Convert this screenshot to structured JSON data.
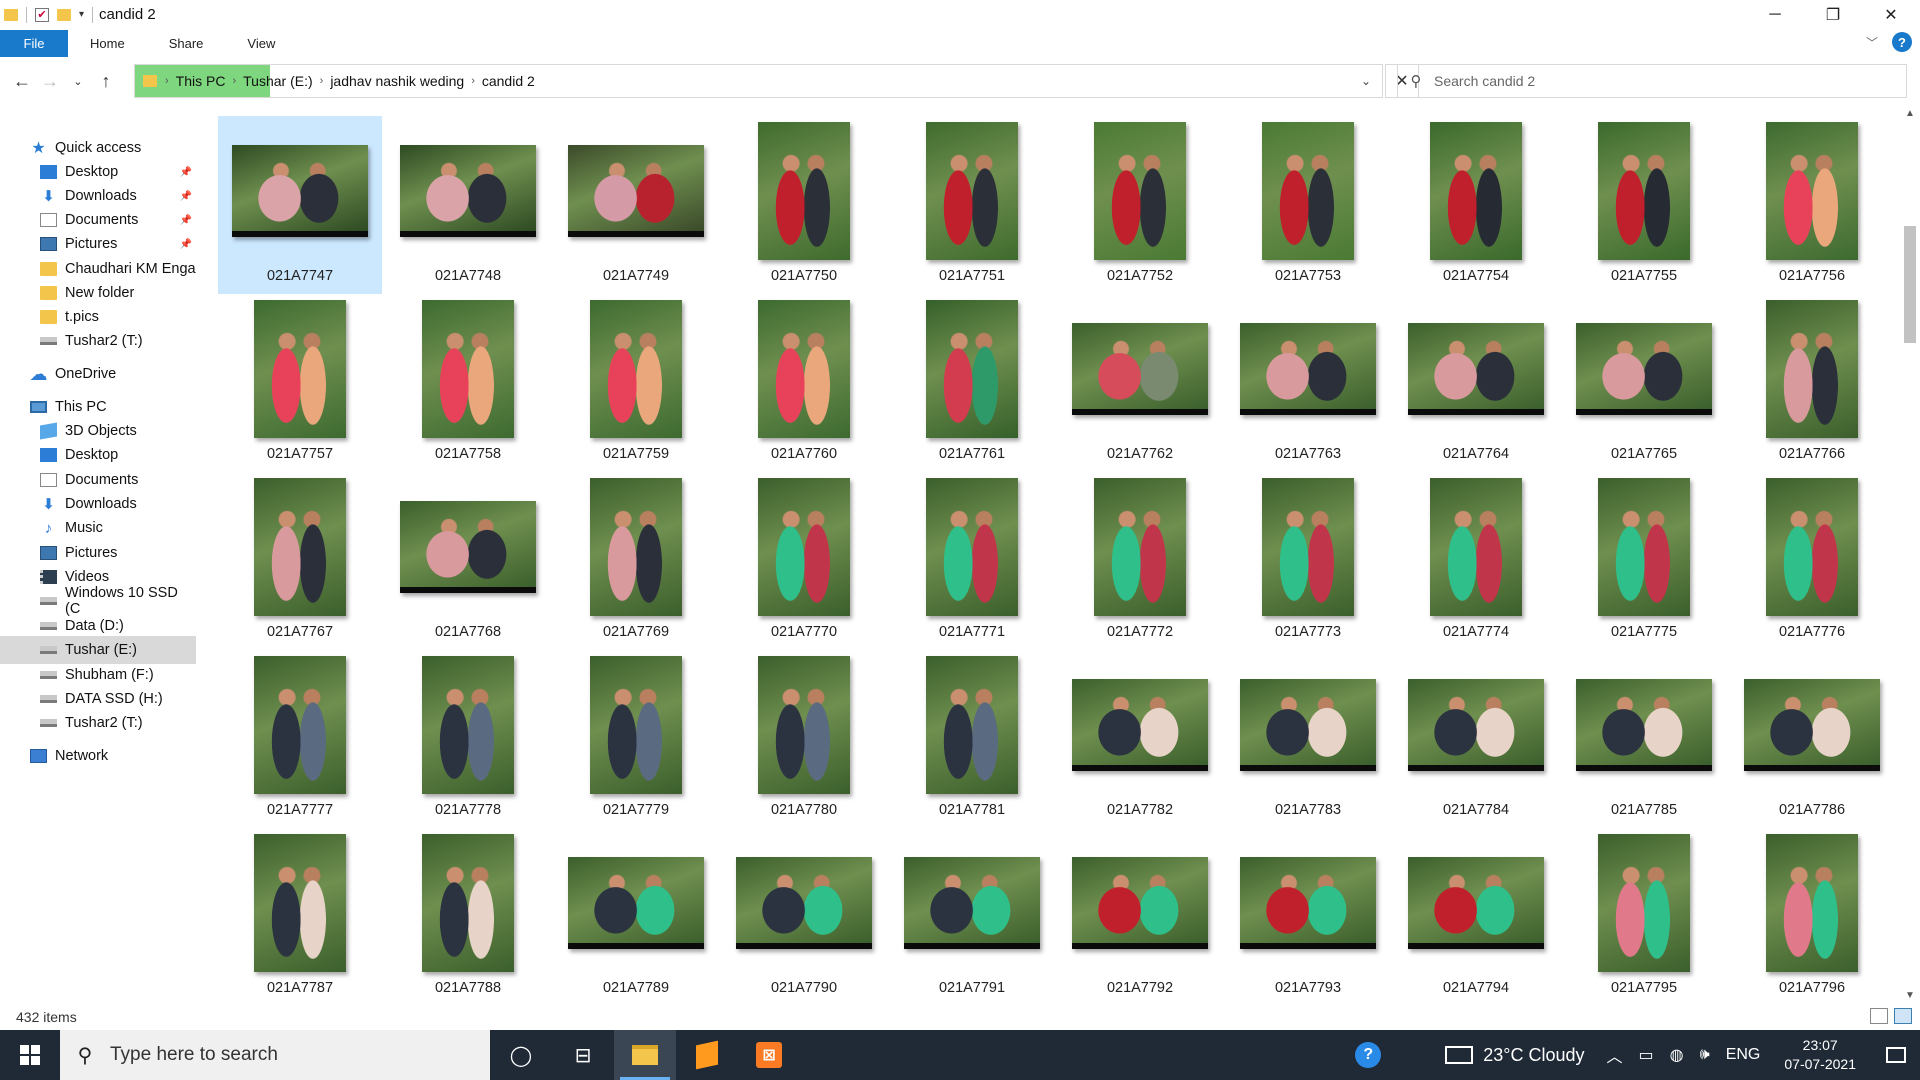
{
  "window": {
    "title": "candid 2",
    "controls": [
      "─",
      "❐",
      "✕"
    ]
  },
  "ribbon": {
    "tabs": [
      "File",
      "Home",
      "Share",
      "View"
    ]
  },
  "address": {
    "crumbs": [
      "This PC",
      "Tushar (E:)",
      "jadhav nashik weding",
      "candid 2"
    ]
  },
  "search": {
    "placeholder": "Search candid 2"
  },
  "sidebar": {
    "items": [
      {
        "label": "Quick access",
        "icon": "star-icon",
        "indent": 0,
        "pinned": false
      },
      {
        "label": "Desktop",
        "icon": "desktop-icon",
        "indent": 1,
        "pinned": true
      },
      {
        "label": "Downloads",
        "icon": "downloads-icon",
        "indent": 1,
        "pinned": true
      },
      {
        "label": "Documents",
        "icon": "documents-icon",
        "indent": 1,
        "pinned": true
      },
      {
        "label": "Pictures",
        "icon": "pictures-icon",
        "indent": 1,
        "pinned": true
      },
      {
        "label": "Chaudhari KM Enga",
        "icon": "folder-icon",
        "indent": 1,
        "pinned": false
      },
      {
        "label": "New folder",
        "icon": "folder-icon",
        "indent": 1,
        "pinned": false
      },
      {
        "label": "t.pics",
        "icon": "folder-icon",
        "indent": 1,
        "pinned": false
      },
      {
        "label": "Tushar2 (T:)",
        "icon": "drive-icon",
        "indent": 1,
        "pinned": false
      },
      {
        "label": "OneDrive",
        "icon": "cloud-icon",
        "indent": 0,
        "pinned": false
      },
      {
        "label": "This PC",
        "icon": "pc-icon",
        "indent": 0,
        "pinned": false
      },
      {
        "label": "3D Objects",
        "icon": "3d-objects-icon",
        "indent": 1,
        "pinned": false
      },
      {
        "label": "Desktop",
        "icon": "desktop-icon",
        "indent": 1,
        "pinned": false
      },
      {
        "label": "Documents",
        "icon": "documents-icon",
        "indent": 1,
        "pinned": false
      },
      {
        "label": "Downloads",
        "icon": "downloads-icon",
        "indent": 1,
        "pinned": false
      },
      {
        "label": "Music",
        "icon": "music-icon",
        "indent": 1,
        "pinned": false
      },
      {
        "label": "Pictures",
        "icon": "pictures-icon",
        "indent": 1,
        "pinned": false
      },
      {
        "label": "Videos",
        "icon": "videos-icon",
        "indent": 1,
        "pinned": false
      },
      {
        "label": "Windows 10 SSD (C",
        "icon": "drive-icon",
        "indent": 1,
        "pinned": false
      },
      {
        "label": "Data (D:)",
        "icon": "drive-icon",
        "indent": 1,
        "pinned": false
      },
      {
        "label": "Tushar (E:)",
        "icon": "drive-icon",
        "indent": 1,
        "pinned": false,
        "selected": true
      },
      {
        "label": "Shubham (F:)",
        "icon": "drive-icon",
        "indent": 1,
        "pinned": false
      },
      {
        "label": "DATA SSD (H:)",
        "icon": "drive-icon",
        "indent": 1,
        "pinned": false
      },
      {
        "label": "Tushar2 (T:)",
        "icon": "drive-icon",
        "indent": 1,
        "pinned": false
      },
      {
        "label": "Network",
        "icon": "network-icon",
        "indent": 0,
        "pinned": false
      }
    ]
  },
  "files": [
    {
      "name": "021A7747",
      "orientation": "landscape",
      "palette": [
        "#2d4a22",
        "#d9a3a8",
        "#2a2f3a"
      ]
    },
    {
      "name": "021A7748",
      "orientation": "landscape",
      "palette": [
        "#2d4a22",
        "#d9a3a8",
        "#2a2f3a"
      ]
    },
    {
      "name": "021A7749",
      "orientation": "landscape",
      "palette": [
        "#3b4a2a",
        "#d49aa6",
        "#b8222e"
      ]
    },
    {
      "name": "021A7750",
      "orientation": "portrait",
      "palette": [
        "#3f6b2e",
        "#c0202b",
        "#2b2f38"
      ]
    },
    {
      "name": "021A7751",
      "orientation": "portrait",
      "palette": [
        "#3f6b2e",
        "#c0202b",
        "#2b2f38"
      ]
    },
    {
      "name": "021A7752",
      "orientation": "portrait",
      "palette": [
        "#4a7a34",
        "#c0202b",
        "#2b2f38"
      ]
    },
    {
      "name": "021A7753",
      "orientation": "portrait",
      "palette": [
        "#4a7a34",
        "#c0202b",
        "#2b2f38"
      ]
    },
    {
      "name": "021A7754",
      "orientation": "portrait",
      "palette": [
        "#3a6a2c",
        "#c0202b",
        "#262a33"
      ]
    },
    {
      "name": "021A7755",
      "orientation": "portrait",
      "palette": [
        "#3a6a2c",
        "#c0202b",
        "#262a33"
      ]
    },
    {
      "name": "021A7756",
      "orientation": "portrait",
      "palette": [
        "#3d6a30",
        "#e8425a",
        "#e9a77b"
      ]
    },
    {
      "name": "021A7757",
      "orientation": "portrait",
      "palette": [
        "#3d6a30",
        "#e8425a",
        "#e9a77b"
      ]
    },
    {
      "name": "021A7758",
      "orientation": "portrait",
      "palette": [
        "#3d6a30",
        "#e8425a",
        "#e9a77b"
      ]
    },
    {
      "name": "021A7759",
      "orientation": "portrait",
      "palette": [
        "#3d6a30",
        "#e8425a",
        "#e9a77b"
      ]
    },
    {
      "name": "021A7760",
      "orientation": "portrait",
      "palette": [
        "#3d6a30",
        "#e8425a",
        "#e9a77b"
      ]
    },
    {
      "name": "021A7761",
      "orientation": "portrait",
      "palette": [
        "#35602a",
        "#d23c4e",
        "#2e9a6a"
      ]
    },
    {
      "name": "021A7762",
      "orientation": "landscape",
      "palette": [
        "#3b5f2c",
        "#d64c5a",
        "#7a8a70"
      ]
    },
    {
      "name": "021A7763",
      "orientation": "landscape",
      "palette": [
        "#3b5f2c",
        "#d99a9e",
        "#2a2f3a"
      ]
    },
    {
      "name": "021A7764",
      "orientation": "landscape",
      "palette": [
        "#3b5f2c",
        "#d99a9e",
        "#2a2f3a"
      ]
    },
    {
      "name": "021A7765",
      "orientation": "landscape",
      "palette": [
        "#3b5f2c",
        "#d99a9e",
        "#2a2f3a"
      ]
    },
    {
      "name": "021A7766",
      "orientation": "portrait",
      "palette": [
        "#3b5f2c",
        "#d99a9e",
        "#2a2f3a"
      ]
    },
    {
      "name": "021A7767",
      "orientation": "portrait",
      "palette": [
        "#3b5f2c",
        "#d99a9e",
        "#2a2f3a"
      ]
    },
    {
      "name": "021A7768",
      "orientation": "landscape",
      "palette": [
        "#3b5f2c",
        "#d99a9e",
        "#2a2f3a"
      ]
    },
    {
      "name": "021A7769",
      "orientation": "portrait",
      "palette": [
        "#3b5f2c",
        "#d99a9e",
        "#2a2f3a"
      ]
    },
    {
      "name": "021A7770",
      "orientation": "portrait",
      "palette": [
        "#3b5f2c",
        "#2fbf8a",
        "#c0354a"
      ]
    },
    {
      "name": "021A7771",
      "orientation": "portrait",
      "palette": [
        "#3b5f2c",
        "#2fbf8a",
        "#c0354a"
      ]
    },
    {
      "name": "021A7772",
      "orientation": "portrait",
      "palette": [
        "#3b5f2c",
        "#2fbf8a",
        "#c0354a"
      ]
    },
    {
      "name": "021A7773",
      "orientation": "portrait",
      "palette": [
        "#3b5f2c",
        "#2fbf8a",
        "#c0354a"
      ]
    },
    {
      "name": "021A7774",
      "orientation": "portrait",
      "palette": [
        "#3b5f2c",
        "#2fbf8a",
        "#c0354a"
      ]
    },
    {
      "name": "021A7775",
      "orientation": "portrait",
      "palette": [
        "#3b5f2c",
        "#2fbf8a",
        "#c0354a"
      ]
    },
    {
      "name": "021A7776",
      "orientation": "portrait",
      "palette": [
        "#3b5f2c",
        "#2fbf8a",
        "#c0354a"
      ]
    },
    {
      "name": "021A7777",
      "orientation": "portrait",
      "palette": [
        "#3b5f2c",
        "#2c3340",
        "#5a6a80"
      ]
    },
    {
      "name": "021A7778",
      "orientation": "portrait",
      "palette": [
        "#3b5f2c",
        "#2c3340",
        "#5a6a80"
      ]
    },
    {
      "name": "021A7779",
      "orientation": "portrait",
      "palette": [
        "#3b5f2c",
        "#2c3340",
        "#5a6a80"
      ]
    },
    {
      "name": "021A7780",
      "orientation": "portrait",
      "palette": [
        "#3b5f2c",
        "#2c3340",
        "#5a6a80"
      ]
    },
    {
      "name": "021A7781",
      "orientation": "portrait",
      "palette": [
        "#3b5f2c",
        "#2c3340",
        "#5a6a80"
      ]
    },
    {
      "name": "021A7782",
      "orientation": "landscape",
      "palette": [
        "#3b5f2c",
        "#2c3340",
        "#e8d3c8"
      ]
    },
    {
      "name": "021A7783",
      "orientation": "landscape",
      "palette": [
        "#3b5f2c",
        "#2c3340",
        "#e8d3c8"
      ]
    },
    {
      "name": "021A7784",
      "orientation": "landscape",
      "palette": [
        "#3b5f2c",
        "#2c3340",
        "#e8d3c8"
      ]
    },
    {
      "name": "021A7785",
      "orientation": "landscape",
      "palette": [
        "#3b5f2c",
        "#2c3340",
        "#e8d3c8"
      ]
    },
    {
      "name": "021A7786",
      "orientation": "landscape",
      "palette": [
        "#3b5f2c",
        "#2c3340",
        "#e8d3c8"
      ]
    },
    {
      "name": "021A7787",
      "orientation": "portrait",
      "palette": [
        "#3b5f2c",
        "#2c3340",
        "#e8d3c8"
      ]
    },
    {
      "name": "021A7788",
      "orientation": "portrait",
      "palette": [
        "#3b5f2c",
        "#2c3340",
        "#e8d3c8"
      ]
    },
    {
      "name": "021A7789",
      "orientation": "landscape",
      "palette": [
        "#3b5f2c",
        "#2c3340",
        "#2fbf8a"
      ]
    },
    {
      "name": "021A7790",
      "orientation": "landscape",
      "palette": [
        "#3b5f2c",
        "#2c3340",
        "#2fbf8a"
      ]
    },
    {
      "name": "021A7791",
      "orientation": "landscape",
      "palette": [
        "#3b5f2c",
        "#2c3340",
        "#2fbf8a"
      ]
    },
    {
      "name": "021A7792",
      "orientation": "landscape",
      "palette": [
        "#3b5f2c",
        "#c0202b",
        "#2fbf8a"
      ]
    },
    {
      "name": "021A7793",
      "orientation": "landscape",
      "palette": [
        "#3b5f2c",
        "#c0202b",
        "#2fbf8a"
      ]
    },
    {
      "name": "021A7794",
      "orientation": "landscape",
      "palette": [
        "#3b5f2c",
        "#c0202b",
        "#2fbf8a"
      ]
    },
    {
      "name": "021A7795",
      "orientation": "portrait",
      "palette": [
        "#3b5f2c",
        "#e07a8a",
        "#2fbf8a"
      ]
    },
    {
      "name": "021A7796",
      "orientation": "portrait",
      "palette": [
        "#3b5f2c",
        "#e07a8a",
        "#2fbf8a"
      ]
    }
  ],
  "status": {
    "items_count": "432 items"
  },
  "taskbar": {
    "search_placeholder": "Type here to search",
    "weather": "23°C  Cloudy",
    "language": "ENG",
    "time": "23:07",
    "date": "07-07-2021"
  },
  "colors": {
    "accent": "#1979ca",
    "selection": "#cce8ff",
    "breadcrumb_highlight": "#7ed67e",
    "taskbar": "#1f2a36"
  }
}
